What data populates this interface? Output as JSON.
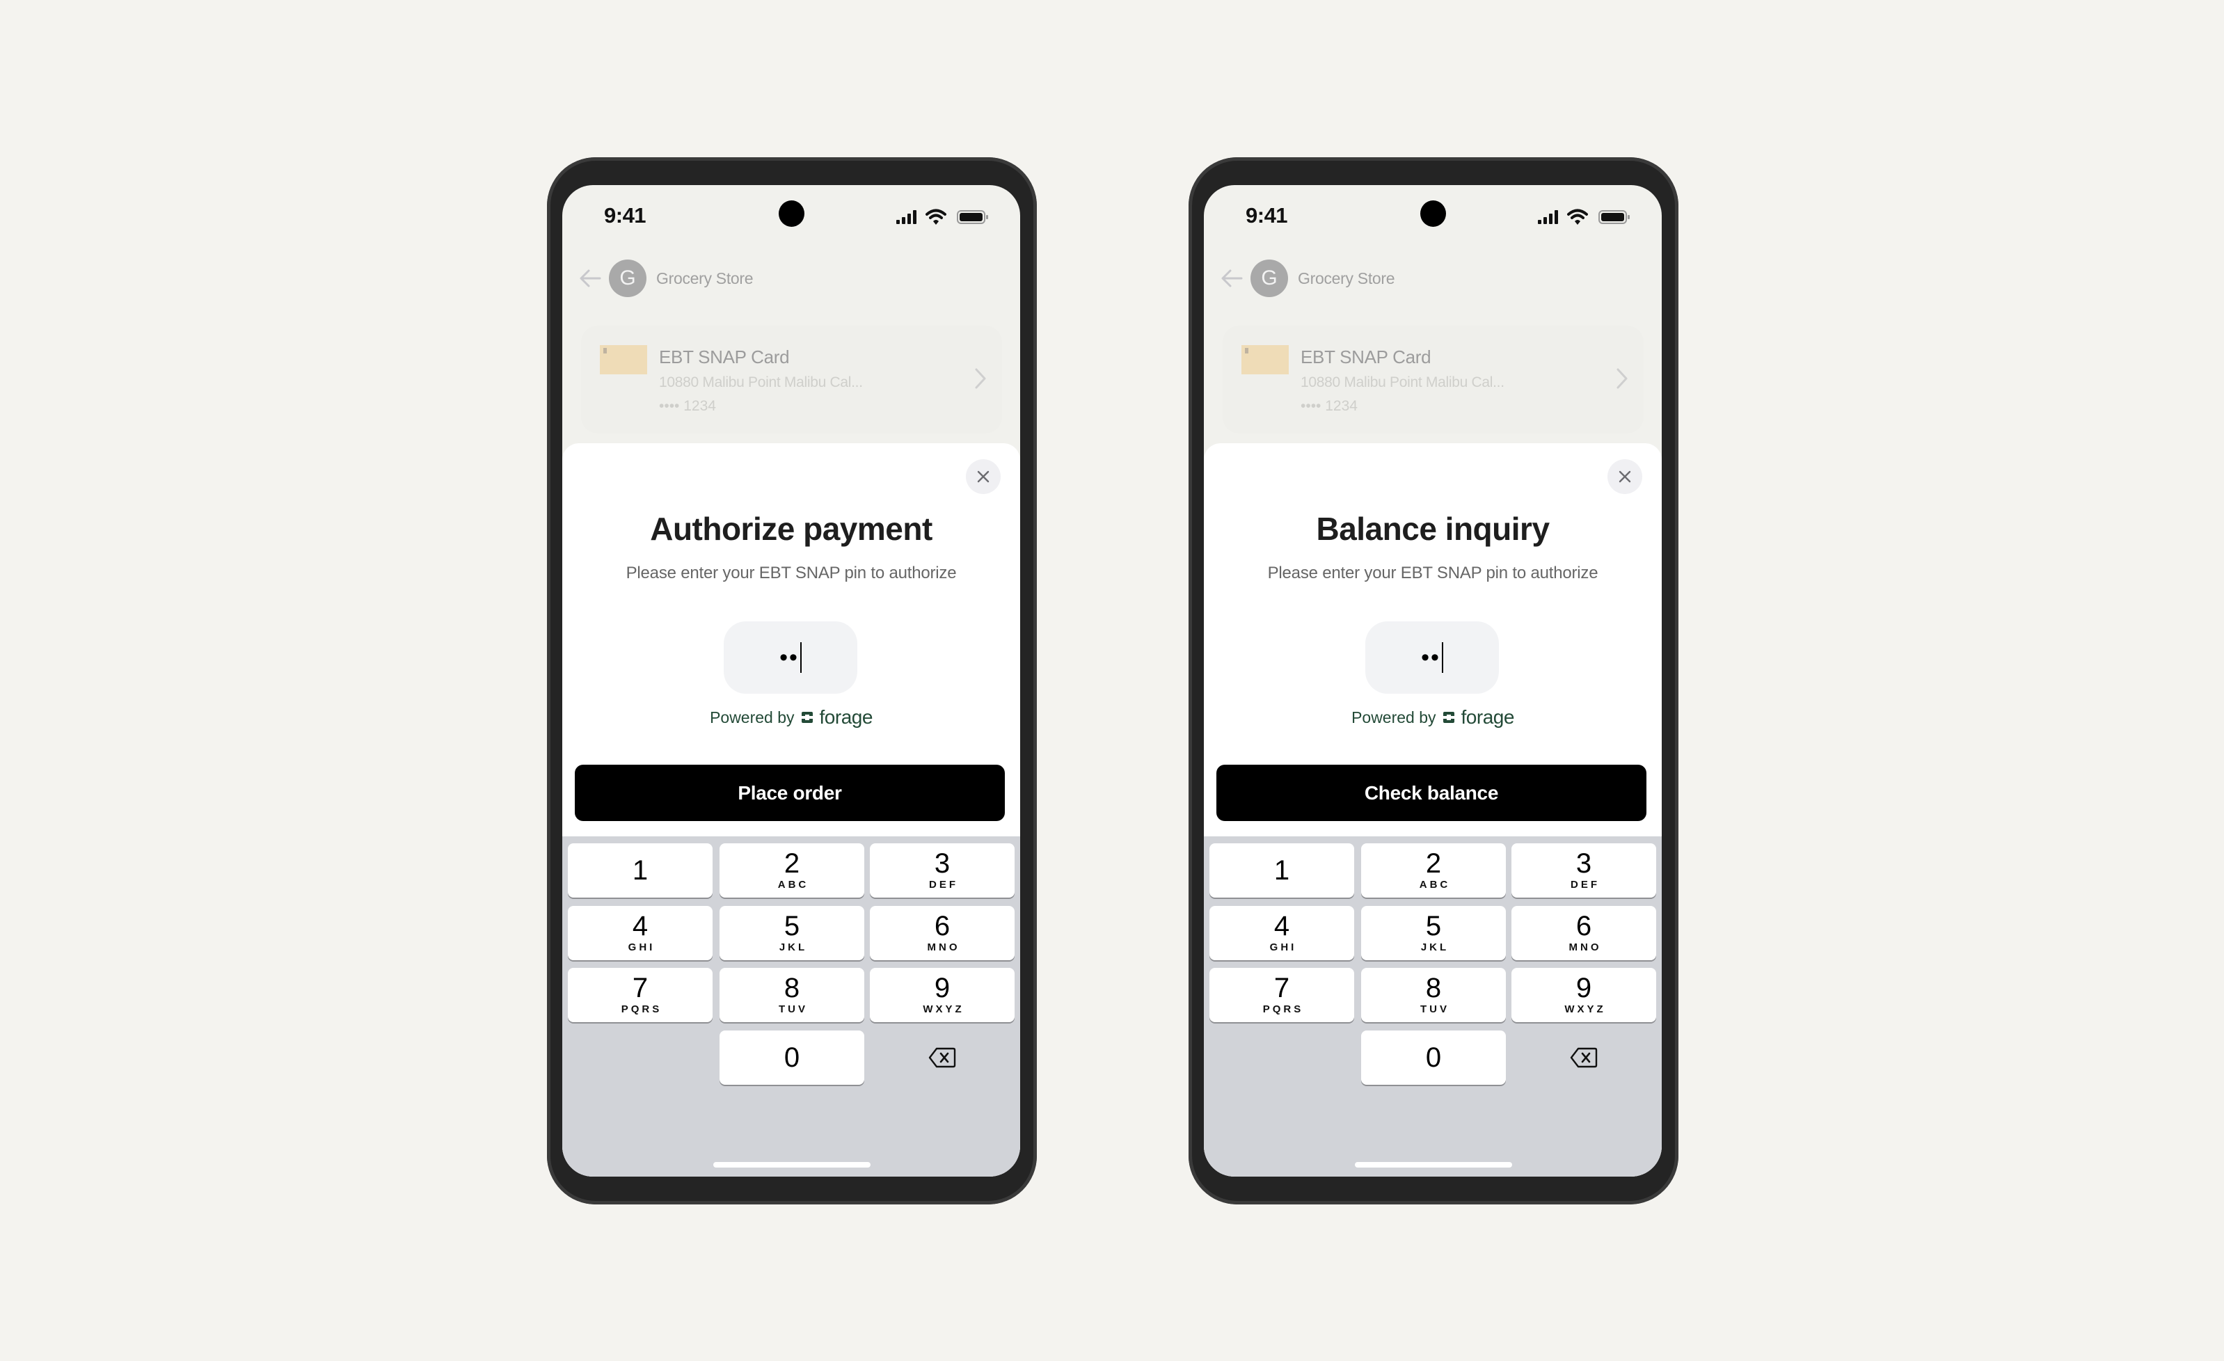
{
  "phones": [
    {
      "status": {
        "time": "9:41",
        "icons": [
          "signal-icon",
          "wifi-icon",
          "battery-icon"
        ]
      },
      "header": {
        "back_icon": "arrow-left-icon",
        "avatar_initial": "G",
        "store_name": "Grocery Store"
      },
      "card": {
        "title": "EBT SNAP Card",
        "address": "10880 Malibu Point Malibu Cal...",
        "last4": "•••• 1234",
        "chevron_icon": "chevron-right-icon"
      },
      "sheet": {
        "close_icon": "close-icon",
        "title": "Authorize payment",
        "subtitle": "Please enter your EBT SNAP pin to authorize",
        "pin_value": "••",
        "powered_by": "Powered by",
        "brand": "forage",
        "button_label": "Place order"
      }
    },
    {
      "status": {
        "time": "9:41",
        "icons": [
          "signal-icon",
          "wifi-icon",
          "battery-icon"
        ]
      },
      "header": {
        "back_icon": "arrow-left-icon",
        "avatar_initial": "G",
        "store_name": "Grocery Store"
      },
      "card": {
        "title": "EBT SNAP Card",
        "address": "10880 Malibu Point Malibu Cal...",
        "last4": "•••• 1234",
        "chevron_icon": "chevron-right-icon"
      },
      "sheet": {
        "close_icon": "close-icon",
        "title": "Balance inquiry",
        "subtitle": "Please enter your EBT SNAP pin to authorize",
        "pin_value": "••",
        "powered_by": "Powered by",
        "brand": "forage",
        "button_label": "Check balance"
      }
    }
  ],
  "keypad": {
    "keys": [
      {
        "digit": "1",
        "letters": ""
      },
      {
        "digit": "2",
        "letters": "ABC"
      },
      {
        "digit": "3",
        "letters": "DEF"
      },
      {
        "digit": "4",
        "letters": "GHI"
      },
      {
        "digit": "5",
        "letters": "JKL"
      },
      {
        "digit": "6",
        "letters": "MNO"
      },
      {
        "digit": "7",
        "letters": "PQRS"
      },
      {
        "digit": "8",
        "letters": "TUV"
      },
      {
        "digit": "9",
        "letters": "WXYZ"
      },
      {
        "digit": "0",
        "letters": ""
      }
    ],
    "backspace_icon": "backspace-icon"
  },
  "colors": {
    "page_bg": "#f4f3ef",
    "brand_green": "#234a37",
    "button_bg": "#000000",
    "keyboard_bg": "#d1d3d8"
  }
}
